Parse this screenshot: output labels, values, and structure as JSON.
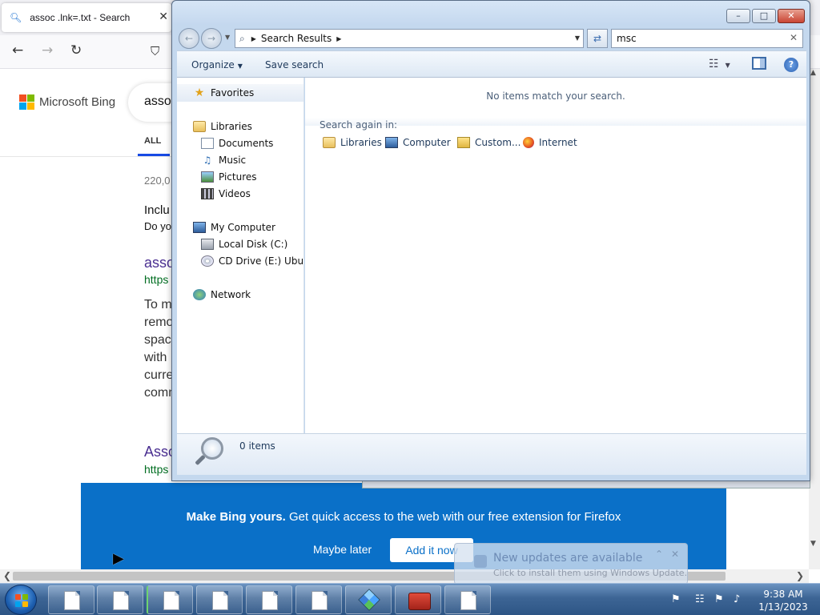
{
  "firefox": {
    "tab_title": "assoc .lnk=.txt - Search",
    "search_query": "assoc",
    "brand": "Microsoft Bing",
    "tab_all": "ALL",
    "result_count": "220,0",
    "includes": "Inclu",
    "do_you": "Do yo",
    "result1_title": "assoc",
    "result1_url": "https",
    "result1_lines": [
      "To m",
      "remo",
      "spac",
      "with",
      "curre",
      "comm"
    ],
    "result2_title": "Asso",
    "result2_url": "https",
    "banner": {
      "bold": "Make Bing yours.",
      "text": " Get quick access to the web with our free extension for Firefox",
      "maybe_later": "Maybe later",
      "add_it_now": "Add it now"
    }
  },
  "explorer": {
    "address_crumb": "Search Results",
    "search_value": "msc",
    "toolbar": {
      "organize": "Organize",
      "save_search": "Save search"
    },
    "nav": {
      "favorites": "Favorites",
      "libraries": "Libraries",
      "documents": "Documents",
      "music": "Music",
      "pictures": "Pictures",
      "videos": "Videos",
      "my_computer": "My Computer",
      "local_disk": "Local Disk (C:)",
      "cd_drive": "CD Drive (E:) Ubuntu",
      "network": "Network"
    },
    "no_items": "No items match your search.",
    "search_again_label": "Search again in:",
    "search_again": [
      "Libraries",
      "Computer",
      "Custom...",
      "Internet"
    ],
    "items_count": "0 items"
  },
  "notification": {
    "title": "New updates are available",
    "subtitle": "Click to install them using Windows Update."
  },
  "taskbar": {
    "time": "9:38 AM",
    "date": "1/13/2023"
  },
  "colors": {
    "bing_banner": "#0a70c8",
    "explorer_frame": "#c4d8ee",
    "taskbar": "#3d6595"
  }
}
